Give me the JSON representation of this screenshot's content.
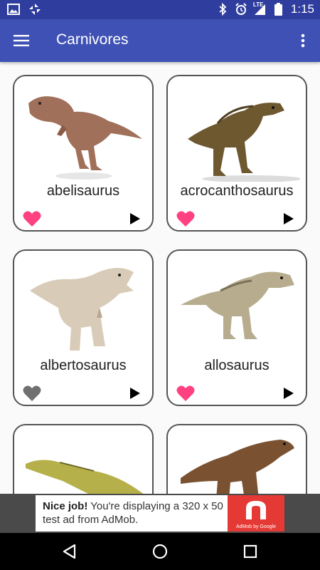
{
  "status_bar": {
    "time": "1:15",
    "lte_label": "LTE"
  },
  "app_bar": {
    "title": "Carnivores"
  },
  "cards": [
    {
      "name": "abelisaurus",
      "favorite": true
    },
    {
      "name": "acrocanthosaurus",
      "favorite": true
    },
    {
      "name": "albertosaurus",
      "favorite": false
    },
    {
      "name": "allosaurus",
      "favorite": true
    },
    {
      "name": "",
      "favorite": false
    },
    {
      "name": "",
      "favorite": false
    }
  ],
  "ad": {
    "headline": "Nice job!",
    "body": "You're displaying a 320 x 50 test ad from AdMob.",
    "brand": "AdMob by Google"
  },
  "colors": {
    "app_bar": "#3f51b5",
    "status_bar": "#2f3e9e",
    "heart_on": "#ff4081",
    "heart_off": "#707070",
    "ad_red": "#e53935"
  }
}
